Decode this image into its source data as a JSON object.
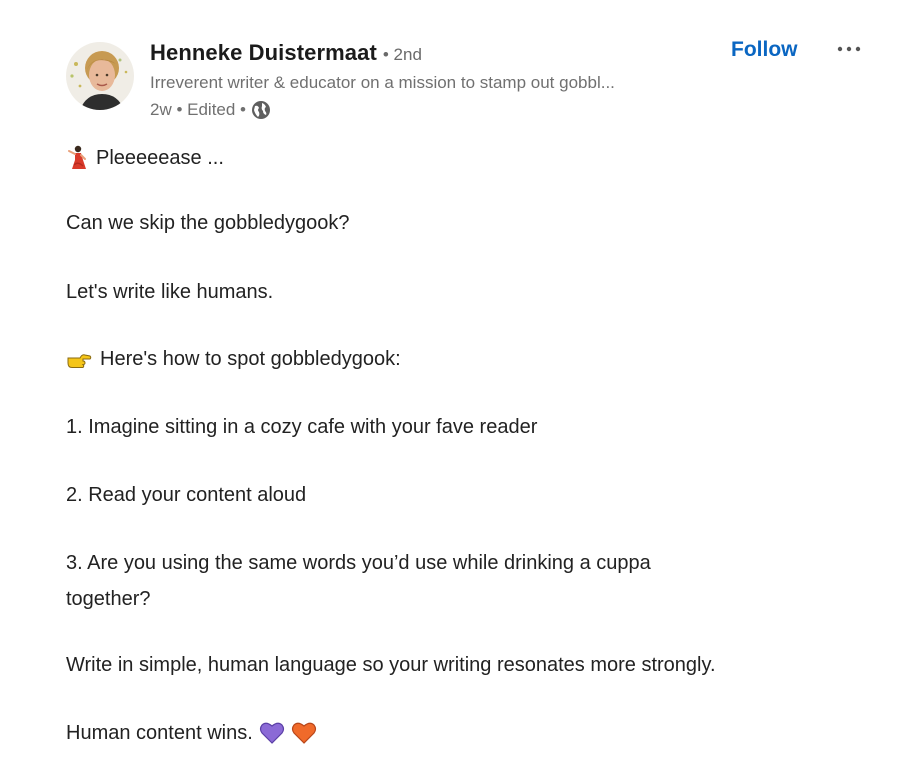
{
  "author": {
    "name": "Henneke Duistermaat",
    "degree": "• 2nd",
    "headline": "Irreverent writer & educator on a mission to stamp out gobbl...",
    "meta": "2w • Edited •"
  },
  "actions": {
    "follow_label": "Follow",
    "more_icon": "ellipsis-icon"
  },
  "post": {
    "line1": "Pleeeeease ...",
    "line2": "Can we skip the gobbledygook?",
    "line3": "Let's write like humans.",
    "line4": "Here's how to spot gobbledygook:",
    "line5": "1. Imagine sitting in a cozy cafe with your fave reader",
    "line6": "2. Read your content aloud",
    "line7a": "3. Are you using the same words you’d use while drinking a cuppa",
    "line7b": "together?",
    "line8": "Write in simple, human language so your writing resonates more strongly.",
    "line9": "Human content wins."
  },
  "icons": {
    "line1_emoji": "dancer-emoji-icon",
    "line4_emoji": "pointing-hand-icon",
    "heart1": "purple-heart-icon",
    "heart2": "orange-heart-icon",
    "visibility": "globe-icon"
  },
  "colors": {
    "accent": "#0a66c2",
    "text": "#222222",
    "muted": "#707070",
    "purple_heart": "#8b6ad6",
    "orange_heart": "#f06a2a"
  }
}
